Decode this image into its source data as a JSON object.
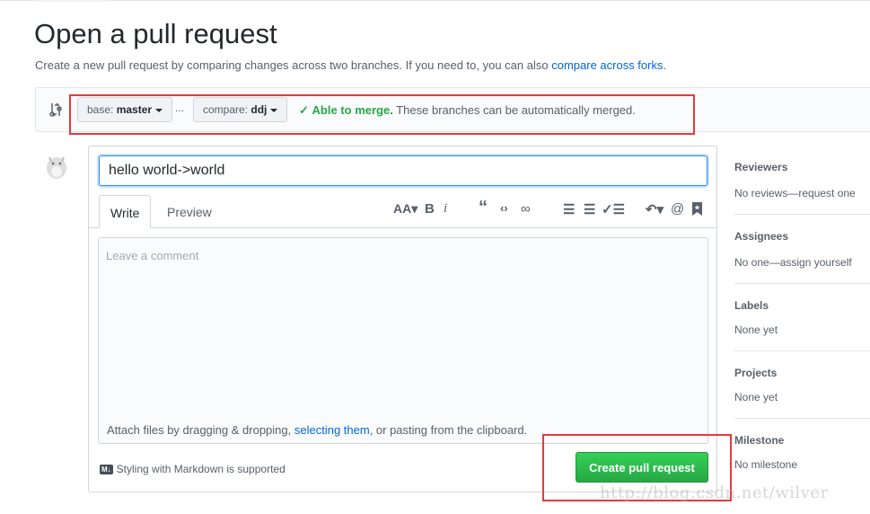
{
  "header": {
    "title": "Open a pull request",
    "subtitle": "Create a new pull request by comparing changes across two branches. If you need to, you can also ",
    "subtitle_link": "compare across forks",
    "subtitle_end": "."
  },
  "compare": {
    "base_label": "base:",
    "base_value": "master",
    "separator": "...",
    "compare_label": "compare:",
    "compare_value": "ddj",
    "merge_status": "Able to merge.",
    "merge_message": "These branches can be automatically merged.",
    "status_color": "#28a745"
  },
  "form": {
    "title_value": "hello world->world",
    "tabs": [
      {
        "label": "Write"
      },
      {
        "label": "Preview"
      }
    ],
    "toolbar": [
      "text-size-icon",
      "bold-icon",
      "italic-icon",
      "quote-icon",
      "code-icon",
      "link-icon",
      "bullet-list-icon",
      "numbered-list-icon",
      "task-list-icon",
      "reply-icon",
      "mention-icon",
      "bookmark-icon"
    ],
    "comment_placeholder": "Leave a comment",
    "attach_text": "Attach files by dragging & dropping, ",
    "attach_link": "selecting them",
    "attach_end": ", or pasting from the clipboard.",
    "markdown_badge": "M↓",
    "markdown_note": "Styling with Markdown is supported",
    "submit_label": "Create pull request",
    "submit_color": "#28a745"
  },
  "sidebar": [
    {
      "heading": "Reviewers",
      "value": "No reviews—request one"
    },
    {
      "heading": "Assignees",
      "value": "No one—assign yourself"
    },
    {
      "heading": "Labels",
      "value": "None yet"
    },
    {
      "heading": "Projects",
      "value": "None yet"
    },
    {
      "heading": "Milestone",
      "value": "No milestone"
    }
  ],
  "watermark": "http://blog.csdn.net/wilver"
}
